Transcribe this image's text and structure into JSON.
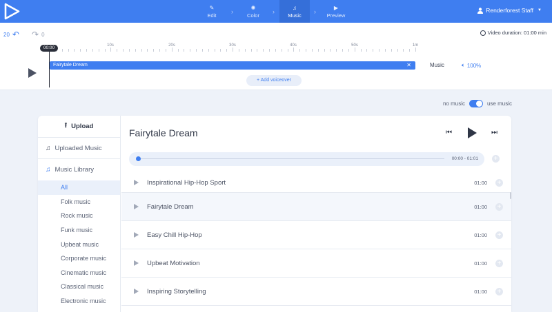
{
  "nav": {
    "steps": [
      {
        "label": "Edit",
        "icon": "pencil-icon",
        "glyph": "✎"
      },
      {
        "label": "Color",
        "icon": "palette-icon",
        "glyph": "✺"
      },
      {
        "label": "Music",
        "icon": "music-note-icon",
        "glyph": "♫"
      },
      {
        "label": "Preview",
        "icon": "play-icon",
        "glyph": "▶"
      }
    ],
    "active_step": "Music",
    "user": "Renderforest Staff"
  },
  "timeline": {
    "undo_count": "20",
    "redo_count": "0",
    "video_duration": "Video duration: 01:00 min",
    "playhead_time": "00:00",
    "ticks": [
      "10s",
      "20s",
      "30s",
      "40s",
      "50s",
      "1m"
    ],
    "track_name": "Fairytale Dream",
    "track_label": "Music",
    "volume": "100%",
    "add_voiceover": "Add voiceover"
  },
  "music_toggle": {
    "off_label": "no music",
    "on_label": "use music",
    "enabled": true
  },
  "sidebar": {
    "upload": "Upload",
    "uploaded_music": "Uploaded Music",
    "music_library": "Music Library",
    "categories": [
      "All",
      "Folk music",
      "Rock music",
      "Funk music",
      "Upbeat music",
      "Corporate music",
      "Cinematic music",
      "Classical music",
      "Electronic music"
    ],
    "active_category": "All"
  },
  "player": {
    "title": "Fairytale Dream",
    "time": "00:00 - 01:01",
    "progress": 0
  },
  "songs": [
    {
      "name": "Inspirational Hip-Hop Sport",
      "duration": "01:00"
    },
    {
      "name": "Fairytale Dream",
      "duration": "01:00"
    },
    {
      "name": "Easy Chill Hip-Hop",
      "duration": "01:00"
    },
    {
      "name": "Upbeat Motivation",
      "duration": "01:00"
    },
    {
      "name": "Inspiring Storytelling",
      "duration": "01:00"
    }
  ],
  "colors": {
    "accent": "#3f7ef0",
    "nav_active": "#356fd9"
  }
}
